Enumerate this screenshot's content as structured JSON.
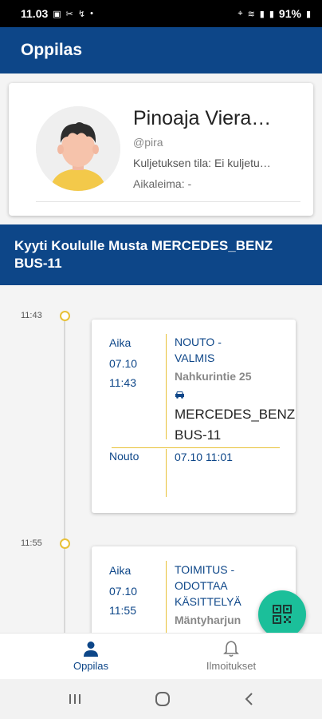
{
  "status_bar": {
    "time": "11.03",
    "battery": "91%"
  },
  "header": {
    "title": "Oppilas"
  },
  "profile": {
    "name": "Pinoaja Viera…",
    "handle": "@pira",
    "transport_status": "Kuljetuksen tila: Ei kuljetu…",
    "timestamp": "Aikaleima: -"
  },
  "trip": {
    "title": "Kyyti Koululle Musta MERCEDES_BENZ BUS-11"
  },
  "timeline": [
    {
      "time": "11:43",
      "time_label": "Aika",
      "date": "07.10",
      "clock": "11:43",
      "status_line1": "NOUTO -",
      "status_line2": "VALMIS",
      "address": "Nahkurintie 25",
      "vehicle_line1": "MERCEDES_BENZ",
      "vehicle_line2": "BUS-11",
      "sub_label": "Nouto",
      "sub_value": "07.10 11:01"
    },
    {
      "time": "11:55",
      "time_label": "Aika",
      "date": "07.10",
      "clock": "11:55",
      "status_line1": "TOIMITUS -",
      "status_line2": "ODOTTAA",
      "status_line3": "KÄSITTELYÄ",
      "address": "Mäntyharjun"
    }
  ],
  "bottom_nav": [
    {
      "label": "Oppilas",
      "icon": "person-icon",
      "active": true
    },
    {
      "label": "Ilmoitukset",
      "icon": "bell-icon",
      "active": false
    }
  ],
  "fab": {
    "icon": "qr-code-icon",
    "color": "#1bbf9a"
  },
  "colors": {
    "primary": "#0d4688",
    "accent": "#e8c138"
  }
}
